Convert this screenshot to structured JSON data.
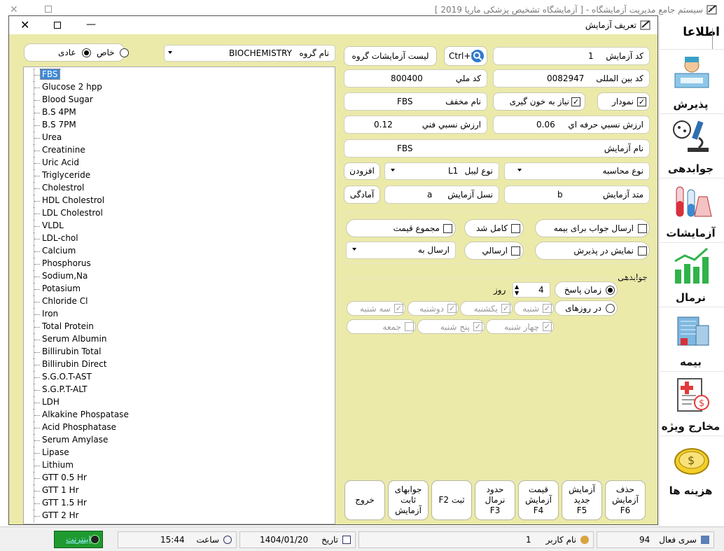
{
  "main_window": {
    "title": "سیستم جامع مدیریت آزمایشگاه - [ آزمایشگاه تشخیص پزشکی ماریا 2019 ]"
  },
  "sidebar": {
    "top_label": "اطلاعا",
    "items": [
      {
        "label": "پذیرش",
        "icon": "reception-icon"
      },
      {
        "label": "جوابدهی",
        "icon": "microscope-icon"
      },
      {
        "label": "آزمایشات",
        "icon": "test-tubes-icon"
      },
      {
        "label": "نرمال",
        "icon": "bar-chart-icon"
      },
      {
        "label": "بیمه",
        "icon": "building-icon"
      },
      {
        "label": "مخارج ویژه",
        "icon": "expense-document-icon"
      },
      {
        "label": "هزینه ها",
        "icon": "coin-icon"
      }
    ]
  },
  "dialog": {
    "title": "تعریف آزمایش",
    "group_label": "نام گروه",
    "group_value": "BIOCHEMISTRY",
    "radio_normal": "عادی",
    "radio_special": "خاص",
    "test_code_label": "کد آزمایش",
    "test_code_value": "1",
    "search_shortcut": "Ctrl+F",
    "group_tests_button": "لیست آزمایشات گروه",
    "intl_code_label": "کد بین المللی",
    "intl_code_value": "0082947",
    "national_code_label": "کد ملي",
    "national_code_value": "800400",
    "chart_label": "نمودار",
    "blood_draw_label": "نیاز به خون گیری",
    "abbr_label": "نام مخفف",
    "abbr_value": "FBS",
    "prof_value_label": "ارزش نسبي حرفه اي",
    "prof_value_value": "0.06",
    "tech_value_label": "ارزش نسبي فني",
    "tech_value_value": "0.12",
    "test_name_label": "نام آزمایش",
    "test_name_value": "FBS",
    "calc_type_label": "نوع محاسبه",
    "calc_type_value": "",
    "label_type_label": "نوع لیبل",
    "label_type_value": "L1",
    "add_button": "افزودن",
    "method_label": "متد آزمایش",
    "method_value": "b",
    "generation_label": "نسل آزمایش",
    "generation_value": "a",
    "ready_button": "آمادگی",
    "send_insurance_label": "ارسال جواب برای بیمه",
    "completed_label": "کامل شد",
    "price_total_label": "مجموع قیمت",
    "show_reception_label": "نمایش در پذیرش",
    "sent_label": "ارسالي",
    "send_to_label": "ارسال به",
    "response_section_title": "جوابدهی",
    "response_time_label": "زمان پاسخ",
    "response_time_value": "4",
    "days_unit": "روز",
    "on_days_label": "در روزهای",
    "days": [
      "شنبه",
      "یکشنبه",
      "دوشنبه",
      "سه شنبه",
      "چهار شنبه",
      "پنج شنبه",
      "جمعه"
    ]
  },
  "test_list": [
    "FBS",
    "Glucose 2 hpp",
    "Blood Sugar",
    "B.S 4PM",
    "B.S 7PM",
    "Urea",
    "Creatinine",
    "Uric Acid",
    "Triglyceride",
    "Cholestrol",
    "HDL Cholestrol",
    "LDL Cholestrol",
    "VLDL",
    "LDL-chol",
    "Calcium",
    "Phosphorus",
    "Sodium,Na",
    "Potasium",
    "Chloride Cl",
    "Iron",
    "Total Protein",
    "Serum Albumin",
    "Billirubin Total",
    "Billirubin Direct",
    "S.G.O.T-AST",
    "S.G.P.T-ALT",
    "LDH",
    "Alkakine Phospatase",
    "Acid Phosphatase",
    "Serum Amylase",
    "Lipase",
    "Lithium",
    "GTT 0.5  Hr",
    "GTT 1 Hr",
    "GTT 1.5 Hr",
    "GTT 2 Hr"
  ],
  "buttons": {
    "delete": [
      "حذف",
      "آزمایش",
      "F6"
    ],
    "new": [
      "آزمایش",
      "جدید",
      "F5"
    ],
    "price": [
      "قیمت",
      "آزمایش",
      "F4"
    ],
    "normal": [
      "حدود",
      "نرمال",
      "F3"
    ],
    "save": "ثبت F2",
    "fixed": [
      "جوابهای",
      "ثابت",
      "آزمایش"
    ],
    "exit": "خروج"
  },
  "statusbar": {
    "active_series_label": "سری فعال",
    "active_series_value": "94",
    "user_label": "نام کاربر",
    "user_value": "1",
    "date_label": "تاریخ",
    "date_value": "1404/01/20",
    "time_label": "ساعت",
    "time_value": "15:44",
    "internet_label": "اینترنت"
  },
  "colors": {
    "dialog_bg": "#ebeaa9",
    "selection": "#3d88d7",
    "internet_green": "#1f9a2f"
  }
}
